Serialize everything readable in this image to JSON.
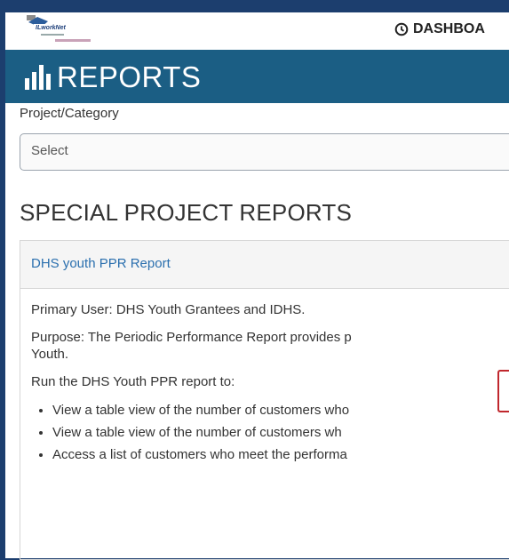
{
  "header": {
    "dashboard_label": "DASHBOA",
    "dashboard_icon": "clock-icon"
  },
  "banner": {
    "title": "REPORTS",
    "icon": "bar-chart-icon"
  },
  "filter": {
    "label": "Project/Category",
    "select_value": "Select"
  },
  "section": {
    "title": "SPECIAL PROJECT REPORTS"
  },
  "report": {
    "title": "DHS youth PPR Report",
    "primary_user": "Primary User: DHS Youth Grantees and IDHS.",
    "purpose_line1": "Purpose: The Periodic Performance Report provides p",
    "purpose_line2": "Youth.",
    "run_text": "Run the DHS Youth PPR report to:",
    "bullets": [
      "View a table view of the number of customers who",
      "View a table view of the number of customers wh",
      "Access a list of customers who meet the performa"
    ]
  },
  "colors": {
    "banner": "#1b5e84",
    "link": "#2a6fae",
    "badge_border": "#c0272d",
    "outer_bg": "#1c3e6e"
  }
}
